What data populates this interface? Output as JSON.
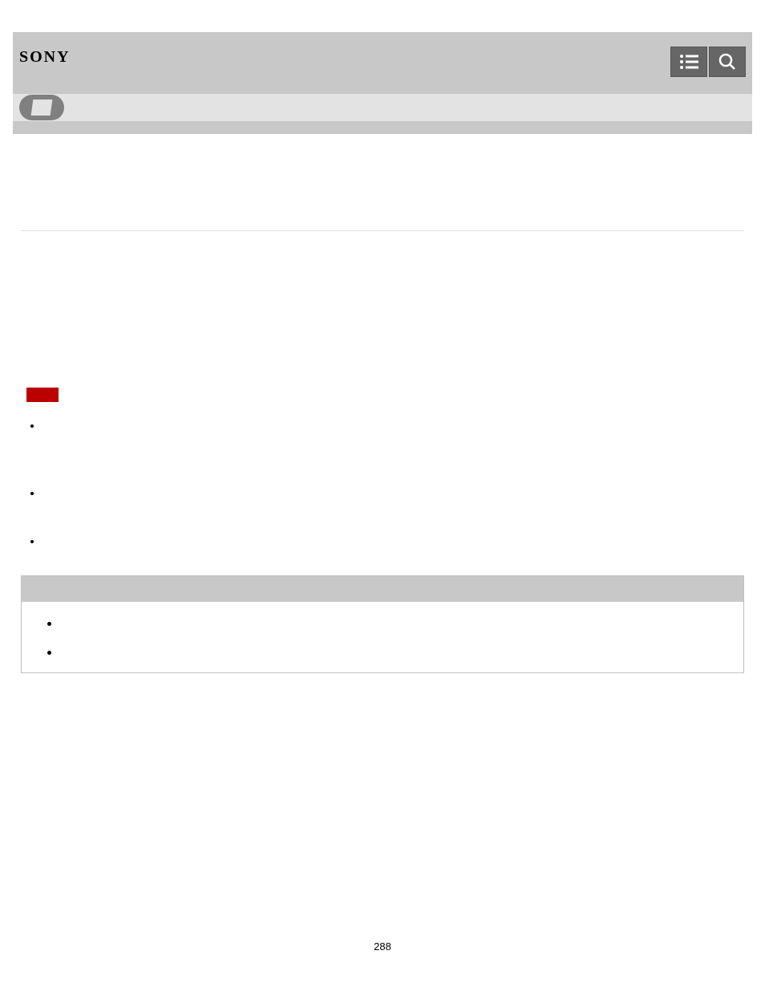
{
  "header": {
    "logo": "SONY"
  },
  "main_list": {
    "item1": "",
    "item2": "",
    "item3": ""
  },
  "sub_list": {
    "item1": "",
    "item2": ""
  },
  "page_number": "288"
}
